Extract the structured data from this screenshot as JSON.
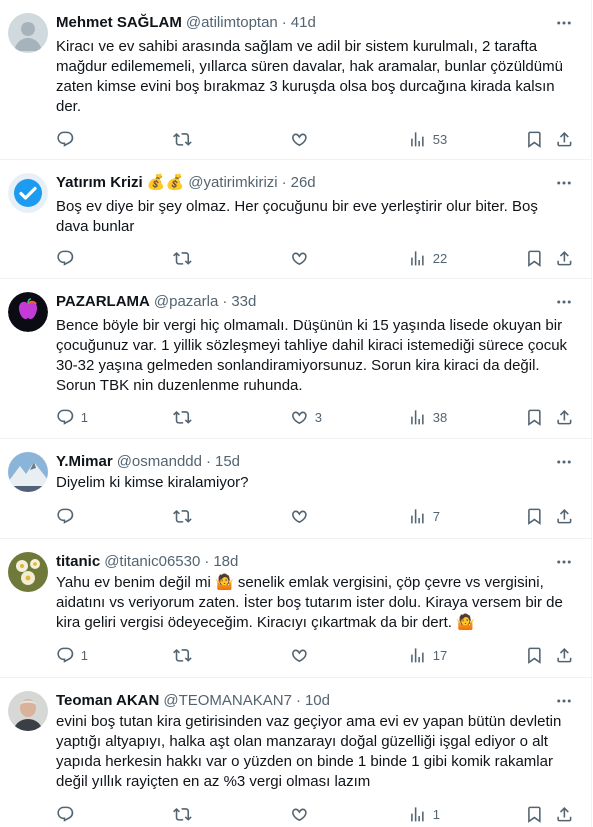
{
  "tweets": [
    {
      "name": "Mehmet SAĞLAM",
      "handle": "@atilimtoptan",
      "sep": "·",
      "time": "41d",
      "text": "Kiracı ve ev sahibi arasında sağlam ve adil bir sistem kurulmalı, 2 tarafta mağdur edilememeli, yıllarca süren davalar, hak aramalar, bunlar çözüldümü zaten kimse evini boş bırakmaz 3 kuruşda olsa boş durcağına kirada kalsın der.",
      "replies": "",
      "reposts": "",
      "likes": "",
      "views": "53"
    },
    {
      "name": "Yatırım Krizi 💰💰",
      "handle": "@yatirimkirizi",
      "sep": "·",
      "time": "26d",
      "text": "Boş ev diye bir şey olmaz. Her çocuğunu bir eve yerleştirir olur biter. Boş dava bunlar",
      "replies": "",
      "reposts": "",
      "likes": "",
      "views": "22"
    },
    {
      "name": "PAZARLAMA",
      "handle": "@pazarla",
      "sep": "·",
      "time": "33d",
      "text": "Bence böyle bir vergi hiç olmamalı. Düşünün ki 15 yaşında lisede okuyan bir çocuğunuz var. 1 yillik sözleşmeyi tahliye dahil kiraci istemediği sürece çocuk 30-32 yaşına gelmeden sonlandiramiyorsunuz. Sorun kira kiraci da değil. Sorun TBK nin duzenlenme ruhunda.",
      "replies": "1",
      "reposts": "",
      "likes": "3",
      "views": "38"
    },
    {
      "name": "Y.Mimar",
      "handle": "@osmanddd",
      "sep": "·",
      "time": "15d",
      "text": "Diyelim ki kimse kiralamiyor?",
      "replies": "",
      "reposts": "",
      "likes": "",
      "views": "7"
    },
    {
      "name": "titanic",
      "handle": "@titanic06530",
      "sep": "·",
      "time": "18d",
      "text": "Yahu ev benim değil mi 🤷 senelik emlak vergisini, çöp çevre vs vergisini, aidatını vs veriyorum zaten. İster boş tutarım ister dolu. Kiraya versem bir de kira geliri vergisi ödeyeceğim. Kiracıyı çıkartmak da bir dert. 🤷",
      "replies": "1",
      "reposts": "",
      "likes": "",
      "views": "17"
    },
    {
      "name": "Teoman AKAN",
      "handle": "@TEOMANAKAN7",
      "sep": "·",
      "time": "10d",
      "text": "evini boş tutan kira getirisinden vaz geçiyor ama evi ev yapan bütün devletin yaptığı altyapıyı, halka aşt olan manzarayı doğal güzelliği işgal ediyor o alt yapıda herkesin hakkı var o yüzden on binde 1 binde 1 gibi komik rakamlar değil yıllık rayiçten en az %3 vergi olması lazım",
      "replies": "",
      "reposts": "",
      "likes": "",
      "views": "1"
    }
  ],
  "icons": {
    "more": "more-icon",
    "reply": "reply-icon",
    "repost": "repost-icon",
    "like": "like-icon",
    "views": "views-icon",
    "bookmark": "bookmark-icon",
    "share": "share-icon"
  },
  "colors": {
    "text": "#0f1419",
    "secondary": "#536471",
    "border": "#eff3f4",
    "verified": "#1d9bf0"
  }
}
